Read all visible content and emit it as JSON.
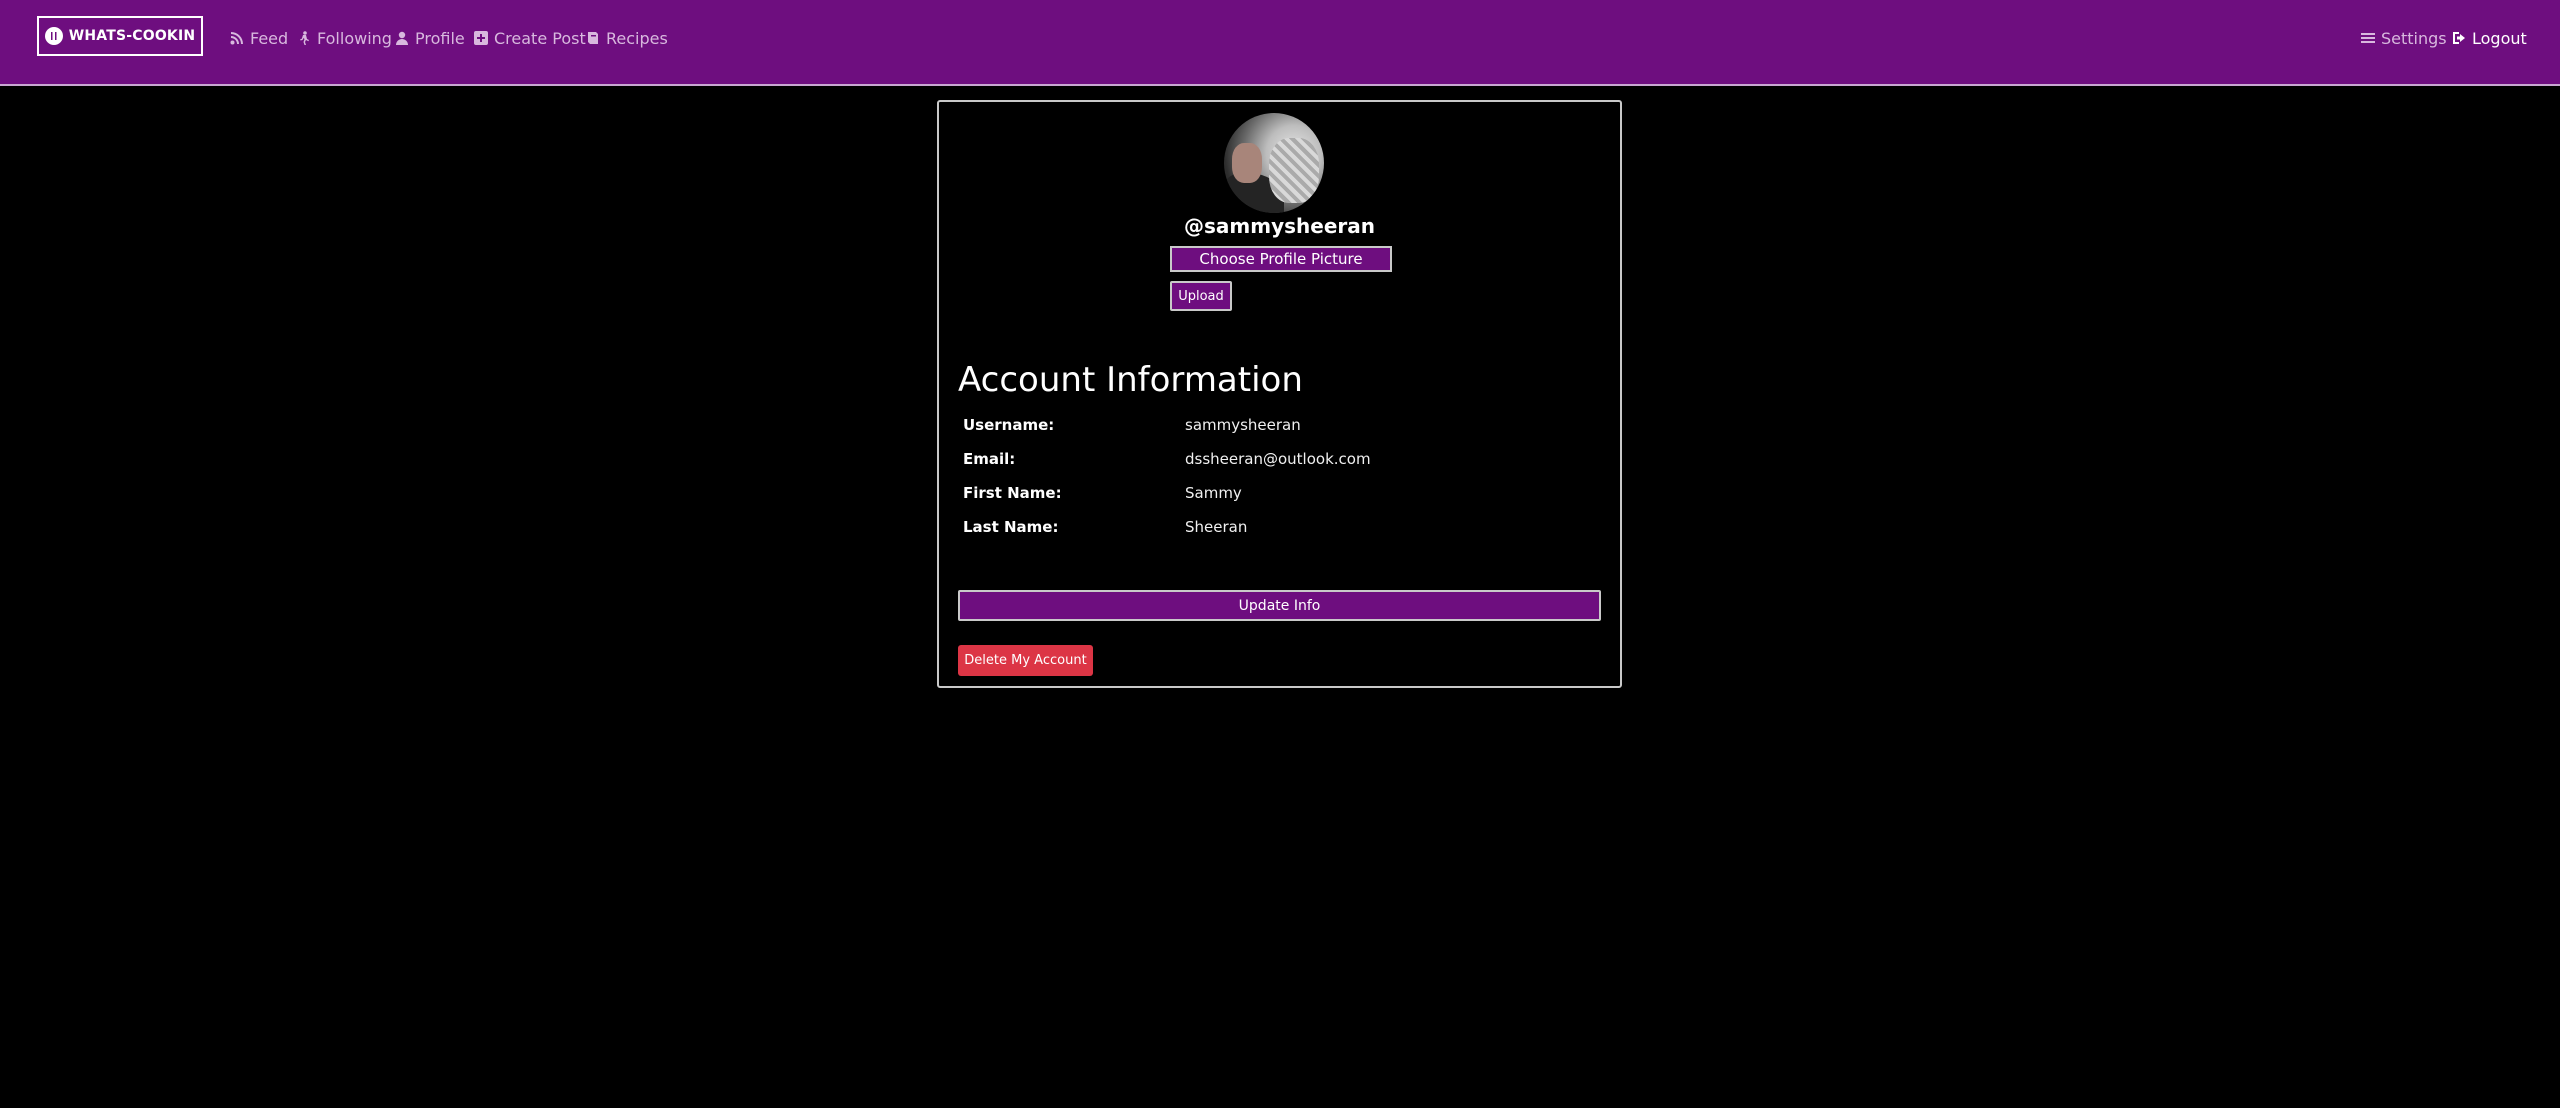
{
  "nav": {
    "brand": "WHATS-COOKIN",
    "links": [
      {
        "label": "Feed",
        "icon": "rss-icon"
      },
      {
        "label": "Following",
        "icon": "walking-icon"
      },
      {
        "label": "Profile",
        "icon": "user-icon"
      },
      {
        "label": "Create Post",
        "icon": "plus-square-icon"
      },
      {
        "label": "Recipes",
        "icon": "book-icon"
      }
    ],
    "right": [
      {
        "label": "Settings",
        "icon": "bars-icon"
      },
      {
        "label": "Logout",
        "icon": "sign-out-icon"
      }
    ]
  },
  "profile": {
    "handle": "@sammysheeran",
    "choose_picture_label": "Choose Profile Picture",
    "upload_label": "Upload"
  },
  "account": {
    "title": "Account Information",
    "fields": [
      {
        "label": "Username:",
        "value": "sammysheeran"
      },
      {
        "label": "Email:",
        "value": "dssheeran@outlook.com"
      },
      {
        "label": "First Name:",
        "value": "Sammy"
      },
      {
        "label": "Last Name:",
        "value": "Sheeran"
      }
    ],
    "update_label": "Update Info",
    "delete_label": "Delete My Account"
  },
  "colors": {
    "brand_purple": "#6e0e7f",
    "danger": "#dc3545",
    "background": "#000000"
  }
}
